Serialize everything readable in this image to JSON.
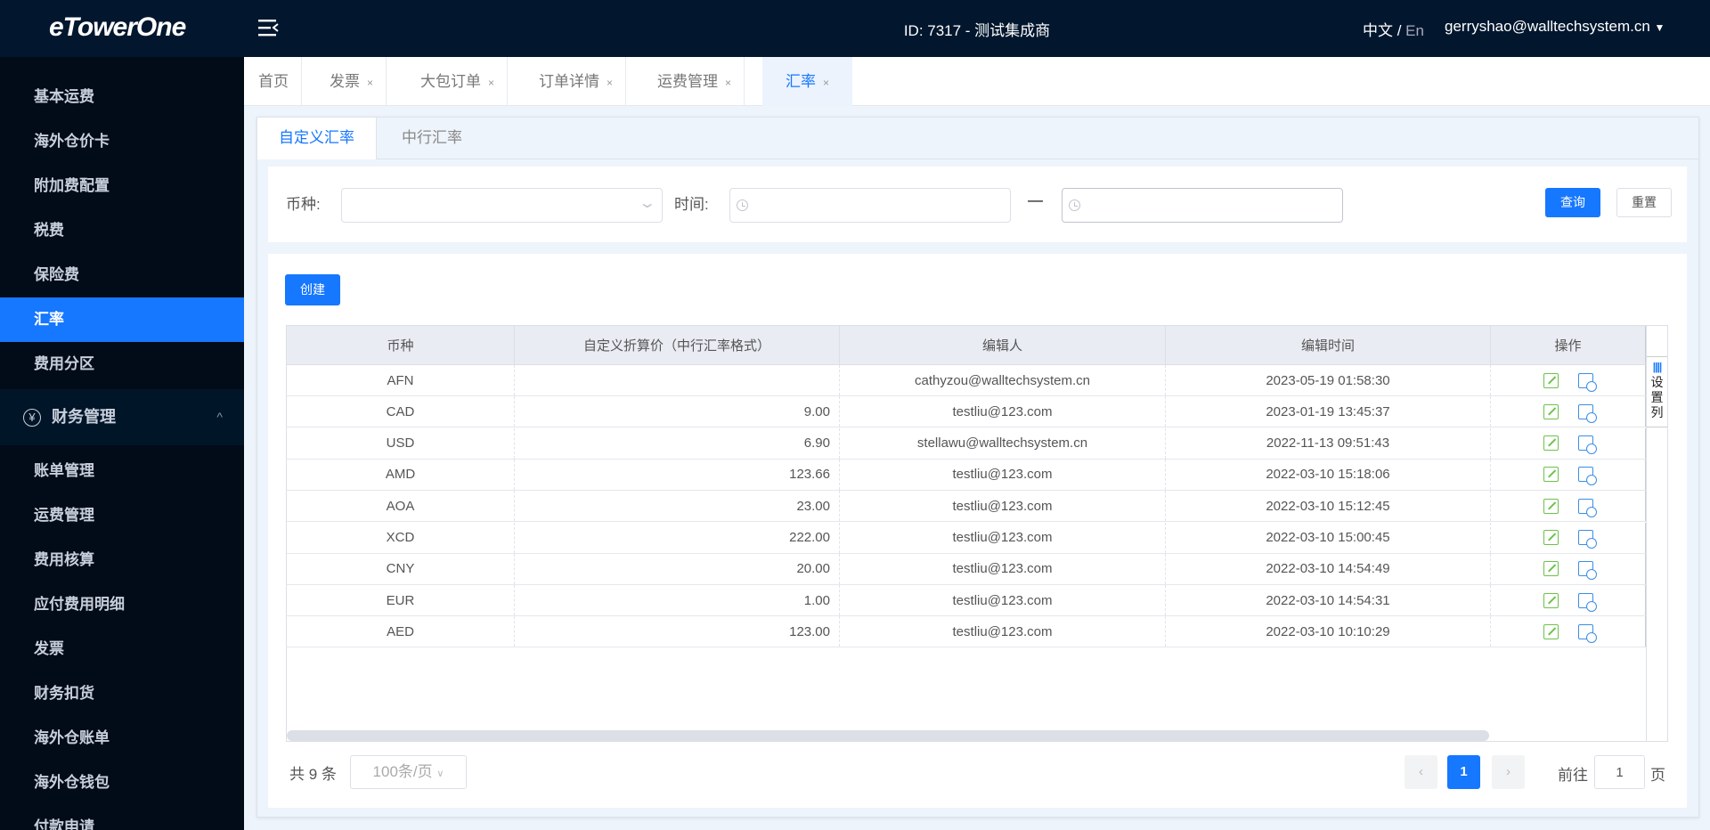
{
  "header": {
    "logo": "eTowerOne",
    "org": "ID: 7317 - 测试集成商",
    "lang_zh": "中文",
    "lang_sep": " / ",
    "lang_en": "En",
    "user": "gerryshao@walltechsystem.cn",
    "caret": "▼"
  },
  "sidebar": {
    "items_top": [
      "基本运费",
      "海外仓价卡",
      "附加费配置",
      "税费",
      "保险费",
      "汇率",
      "费用分区"
    ],
    "active": "汇率",
    "group": {
      "label": "财务管理",
      "icon": "yen-icon",
      "chevron": "^"
    },
    "items_group": [
      "账单管理",
      "运费管理",
      "费用核算",
      "应付费用明细",
      "发票",
      "财务扣货",
      "海外仓账单",
      "海外仓钱包",
      "付款申请"
    ]
  },
  "tabs": [
    {
      "label": "首页",
      "closable": false
    },
    {
      "label": "发票",
      "closable": true
    },
    {
      "label": "大包订单",
      "closable": true
    },
    {
      "label": "订单详情",
      "closable": true
    },
    {
      "label": "运费管理",
      "closable": true
    },
    {
      "label": "汇率",
      "closable": true,
      "active": true
    }
  ],
  "tab_close": "×",
  "subtabs": [
    {
      "label": "自定义汇率",
      "active": true
    },
    {
      "label": "中行汇率"
    }
  ],
  "filter": {
    "currency_label": "币种:",
    "currency_value": "",
    "time_label": "时间:",
    "time_sep": "—",
    "start": "",
    "end": "",
    "search": "查询",
    "reset": "重置"
  },
  "create": "创建",
  "table": {
    "columns": [
      "币种",
      "自定义折算价（中行汇率格式）",
      "编辑人",
      "编辑时间",
      "操作"
    ],
    "rows": [
      [
        "AFN",
        "",
        "cathyzou@walltechsystem.cn",
        "2023-05-19 01:58:30"
      ],
      [
        "CAD",
        "9.00",
        "testliu@123.com",
        "2023-01-19 13:45:37"
      ],
      [
        "USD",
        "6.90",
        "stellawu@walltechsystem.cn",
        "2022-11-13 09:51:43"
      ],
      [
        "AMD",
        "123.66",
        "testliu@123.com",
        "2022-03-10 15:18:06"
      ],
      [
        "AOA",
        "23.00",
        "testliu@123.com",
        "2022-03-10 15:12:45"
      ],
      [
        "XCD",
        "222.00",
        "testliu@123.com",
        "2022-03-10 15:00:45"
      ],
      [
        "CNY",
        "20.00",
        "testliu@123.com",
        "2022-03-10 14:54:49"
      ],
      [
        "EUR",
        "1.00",
        "testliu@123.com",
        "2022-03-10 14:54:31"
      ],
      [
        "AED",
        "123.00",
        "testliu@123.com",
        "2022-03-10 10:10:29"
      ]
    ],
    "set_columns": "设置列"
  },
  "pagination": {
    "total": "共 9 条",
    "page_size": "100条/页",
    "current": "1",
    "prev": "‹",
    "next": "›",
    "goto_label": "前往",
    "goto_value": "1",
    "goto_suffix": "页"
  },
  "colors": {
    "primary": "#1677ff",
    "header": "#02172e",
    "sidebar": "#020b18",
    "edit": "#6cc24a",
    "history": "#3a8ee6"
  }
}
